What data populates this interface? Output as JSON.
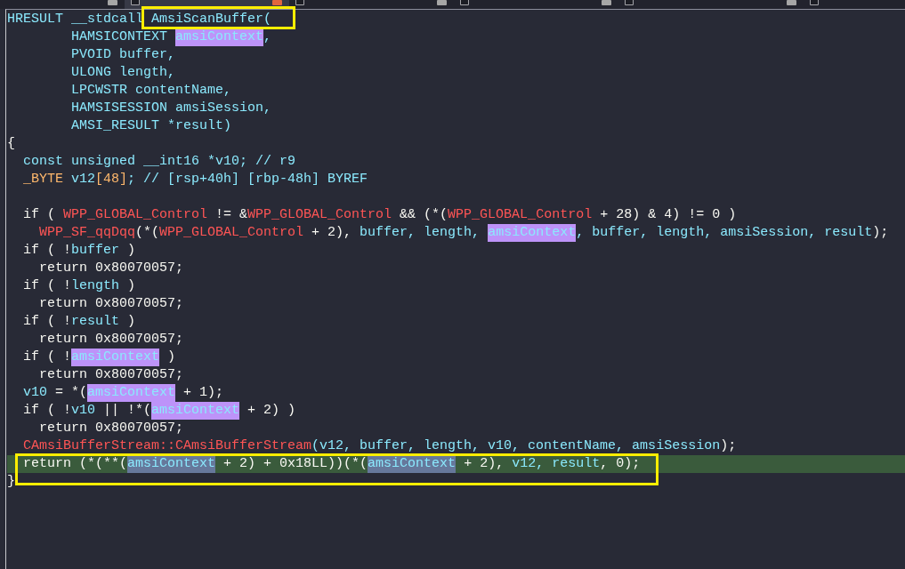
{
  "tabs": [
    {
      "selected": false,
      "icon": false,
      "close_button": true
    },
    {
      "selected": true,
      "icon": true,
      "close_button": true
    },
    {
      "selected": false,
      "icon": true,
      "close_button": true
    },
    {
      "selected": false,
      "icon": true,
      "close_button": true
    },
    {
      "selected": false,
      "icon": true,
      "close_button": true
    },
    {
      "selected": false,
      "icon": true,
      "close_button": false
    }
  ],
  "code": {
    "lines": [
      {
        "current": false,
        "segments": [
          {
            "text": "HRESULT __stdcall ",
            "kind": "name"
          },
          {
            "text": "AmsiScanBuffer(",
            "kind": "name",
            "boxed": true
          }
        ]
      },
      {
        "current": false,
        "segments": [
          {
            "text": "        HAMSICONTEXT ",
            "kind": "name"
          },
          {
            "text": "amsiContext",
            "kind": "match"
          },
          {
            "text": ",",
            "kind": "name"
          }
        ]
      },
      {
        "current": false,
        "segments": [
          {
            "text": "        PVOID buffer,",
            "kind": "name"
          }
        ]
      },
      {
        "current": false,
        "segments": [
          {
            "text": "        ULONG length,",
            "kind": "name"
          }
        ]
      },
      {
        "current": false,
        "segments": [
          {
            "text": "        LPCWSTR contentName,",
            "kind": "name"
          }
        ]
      },
      {
        "current": false,
        "segments": [
          {
            "text": "        HAMSISESSION amsiSession,",
            "kind": "name"
          }
        ]
      },
      {
        "current": false,
        "segments": [
          {
            "text": "        AMSI_RESULT *result)",
            "kind": "name"
          }
        ]
      },
      {
        "current": false,
        "segments": [
          {
            "text": "{",
            "kind": "plain"
          }
        ]
      },
      {
        "current": false,
        "segments": [
          {
            "text": "  const unsigned __int16 *v10; // r9",
            "kind": "name"
          }
        ]
      },
      {
        "current": false,
        "segments": [
          {
            "text": "  _BYTE",
            "kind": "type"
          },
          {
            "text": " v12",
            "kind": "name"
          },
          {
            "text": "[48]",
            "kind": "type"
          },
          {
            "text": "; // [rsp+40h] [rbp-48h] BYREF",
            "kind": "name"
          }
        ]
      },
      {
        "current": false
      },
      {
        "current": false,
        "segments": [
          {
            "text": "  if ( ",
            "kind": "plain"
          },
          {
            "text": "WPP_GLOBAL_Control",
            "kind": "global"
          },
          {
            "text": " != &",
            "kind": "plain"
          },
          {
            "text": "WPP_GLOBAL_Control",
            "kind": "global"
          },
          {
            "text": " && (*(",
            "kind": "plain"
          },
          {
            "text": "WPP_GLOBAL_Control",
            "kind": "global"
          },
          {
            "text": " + 28) & 4) != 0 )",
            "kind": "plain"
          }
        ]
      },
      {
        "current": false,
        "segments": [
          {
            "text": "    WPP_SF_qqDqq",
            "kind": "global"
          },
          {
            "text": "(*(",
            "kind": "plain"
          },
          {
            "text": "WPP_GLOBAL_Control",
            "kind": "global"
          },
          {
            "text": " + 2), ",
            "kind": "plain"
          },
          {
            "text": "buffer, length, ",
            "kind": "name"
          },
          {
            "text": "amsiContext",
            "kind": "match"
          },
          {
            "text": ", buffer, length, amsiSession, result",
            "kind": "name"
          },
          {
            "text": ");",
            "kind": "plain"
          }
        ]
      },
      {
        "current": false,
        "segments": [
          {
            "text": "  if ( !",
            "kind": "plain"
          },
          {
            "text": "buffer",
            "kind": "name"
          },
          {
            "text": " )",
            "kind": "plain"
          }
        ]
      },
      {
        "current": false,
        "segments": [
          {
            "text": "    return 0x80070057;",
            "kind": "plain"
          }
        ]
      },
      {
        "current": false,
        "segments": [
          {
            "text": "  if ( !",
            "kind": "plain"
          },
          {
            "text": "length",
            "kind": "name"
          },
          {
            "text": " )",
            "kind": "plain"
          }
        ]
      },
      {
        "current": false,
        "segments": [
          {
            "text": "    return 0x80070057;",
            "kind": "plain"
          }
        ]
      },
      {
        "current": false,
        "segments": [
          {
            "text": "  if ( !",
            "kind": "plain"
          },
          {
            "text": "result",
            "kind": "name"
          },
          {
            "text": " )",
            "kind": "plain"
          }
        ]
      },
      {
        "current": false,
        "segments": [
          {
            "text": "    return 0x80070057;",
            "kind": "plain"
          }
        ]
      },
      {
        "current": false,
        "segments": [
          {
            "text": "  if ( !",
            "kind": "plain"
          },
          {
            "text": "amsiContext",
            "kind": "match"
          },
          {
            "text": " )",
            "kind": "plain"
          }
        ]
      },
      {
        "current": false,
        "segments": [
          {
            "text": "    return 0x80070057;",
            "kind": "plain"
          }
        ]
      },
      {
        "current": false,
        "segments": [
          {
            "text": "  v10",
            "kind": "name"
          },
          {
            "text": " = *(",
            "kind": "plain"
          },
          {
            "text": "amsiContext",
            "kind": "match"
          },
          {
            "text": " + 1);",
            "kind": "plain"
          }
        ]
      },
      {
        "current": false,
        "segments": [
          {
            "text": "  if ( !",
            "kind": "plain"
          },
          {
            "text": "v10",
            "kind": "name"
          },
          {
            "text": " || !*(",
            "kind": "plain"
          },
          {
            "text": "amsiContext",
            "kind": "match"
          },
          {
            "text": " + 2) )",
            "kind": "plain"
          }
        ]
      },
      {
        "current": false,
        "segments": [
          {
            "text": "    return 0x80070057;",
            "kind": "plain"
          }
        ]
      },
      {
        "current": false,
        "segments": [
          {
            "text": "  CAmsiBufferStream::CAmsiBufferStream",
            "kind": "global"
          },
          {
            "text": "(v12, buffer, length, v10, contentName, amsiSession",
            "kind": "name"
          },
          {
            "text": ");",
            "kind": "plain"
          }
        ]
      },
      {
        "current": true,
        "boxed": true,
        "segments": [
          {
            "text": "  return (*(**(",
            "kind": "plain"
          },
          {
            "text": "amsiContext",
            "kind": "match"
          },
          {
            "text": " + 2) + 0x18LL))(*(",
            "kind": "plain"
          },
          {
            "text": "amsiContext",
            "kind": "match"
          },
          {
            "text": " + 2), ",
            "kind": "plain"
          },
          {
            "text": "v12, result",
            "kind": "name"
          },
          {
            "text": ", 0);",
            "kind": "plain"
          }
        ]
      },
      {
        "current": false,
        "segments": [
          {
            "text": "}",
            "kind": "plain"
          }
        ]
      }
    ]
  }
}
